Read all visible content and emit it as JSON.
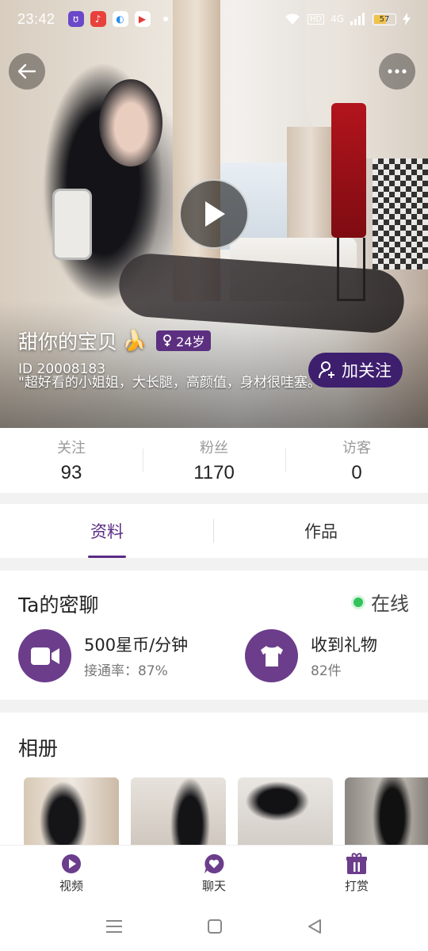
{
  "status_bar": {
    "time": "23:42",
    "network": "4G",
    "hd": "HD",
    "battery": "57",
    "apps": [
      {
        "icon": "soul-app-icon",
        "color": "#6b48c9"
      },
      {
        "icon": "music-app-icon",
        "color": "#e8413b"
      },
      {
        "icon": "browser-app-icon",
        "color": "#2a8bf0"
      },
      {
        "icon": "video-app-icon",
        "color": "#e23b3b"
      }
    ]
  },
  "profile": {
    "name": "甜你的宝贝",
    "name_emoji": "🍌",
    "age": "24岁",
    "user_id": "ID 20008183",
    "bio": "\"超好看的小姐姐，大长腿，高颜值，身材很哇塞。\"",
    "follow_label": "加关注"
  },
  "stats": [
    {
      "label": "关注",
      "value": "93"
    },
    {
      "label": "粉丝",
      "value": "1170"
    },
    {
      "label": "访客",
      "value": "0"
    }
  ],
  "tabs": [
    {
      "label": "资料",
      "active": true
    },
    {
      "label": "作品",
      "active": false
    }
  ],
  "private_chat": {
    "title": "Ta的密聊",
    "online_label": "在线",
    "video_rate": "500星币/分钟",
    "connect_rate": "接通率：87%",
    "gifts_title": "收到礼物",
    "gifts_count": "82件"
  },
  "album": {
    "title": "相册",
    "photo_count": 4
  },
  "bottom_nav": [
    {
      "label": "视频",
      "icon": "video-nav-icon"
    },
    {
      "label": "聊天",
      "icon": "chat-heart-icon"
    },
    {
      "label": "打赏",
      "icon": "gift-box-icon"
    }
  ],
  "colors": {
    "accent": "#5a2c85",
    "follow_button": "#3e1f6e",
    "feature_icon_bg": "#6b3d8b",
    "online": "#32c45a"
  }
}
